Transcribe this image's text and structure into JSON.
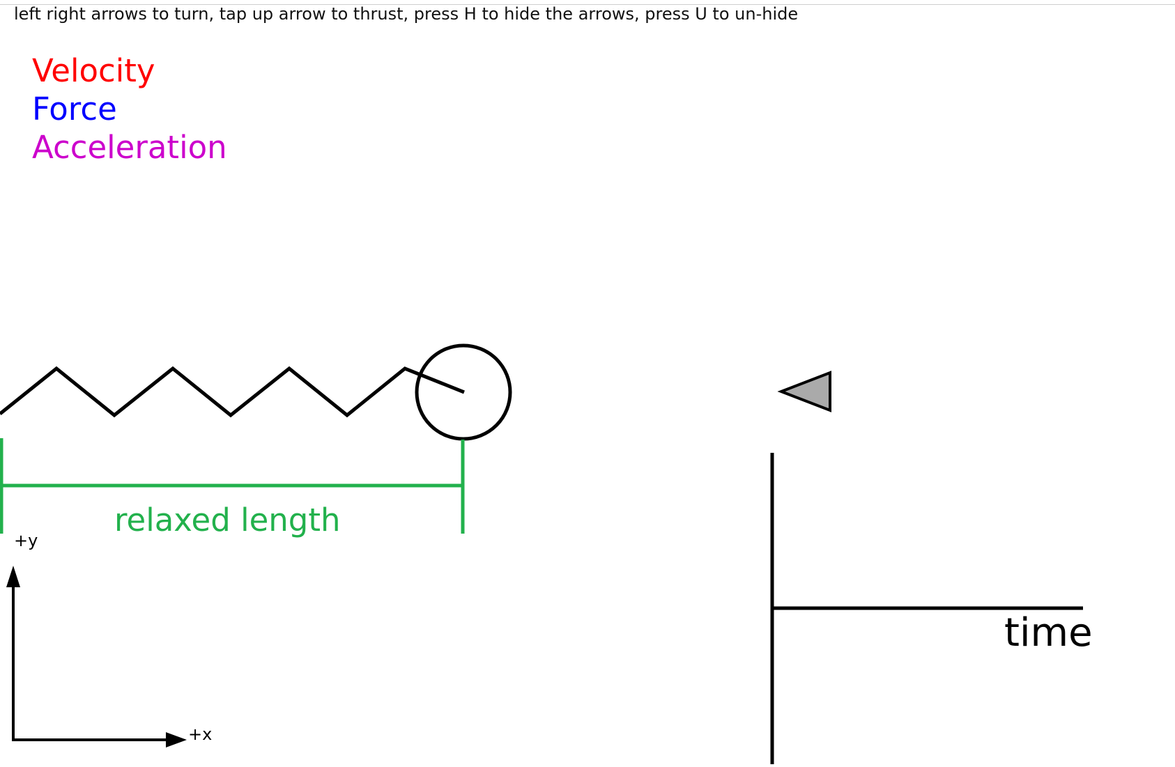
{
  "instructions": "left right arrows to turn, tap up arrow to thrust, press H to hide the arrows, press U to un-hide",
  "legend": {
    "velocity": "Velocity",
    "force": "Force",
    "acceleration": "Acceleration"
  },
  "colors": {
    "velocity": "#ff0000",
    "force": "#0000ff",
    "acceleration": "#cc00cc",
    "relaxed_length": "#22b14c",
    "ship_fill": "#aaaaaa",
    "ink": "#000000"
  },
  "simulation": {
    "relaxed_length_label": "relaxed length",
    "axis_x_label": "+x",
    "axis_y_label": "+y"
  },
  "graph": {
    "time_label": "time"
  }
}
